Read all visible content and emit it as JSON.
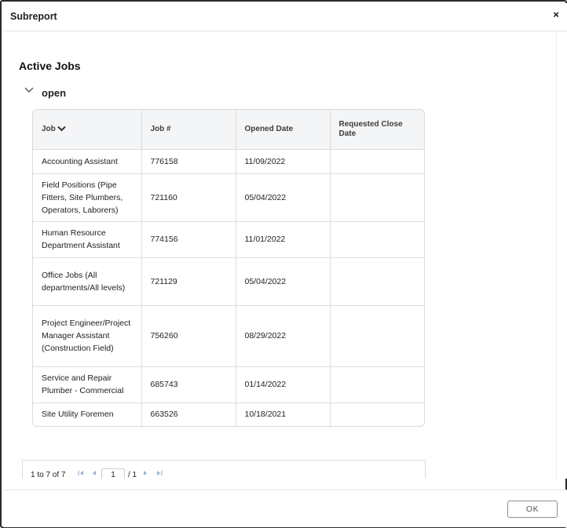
{
  "dialog": {
    "title": "Subreport",
    "close_label": "×",
    "ok_label": "OK"
  },
  "section": {
    "title": "Active Jobs"
  },
  "group": {
    "label": "open"
  },
  "table": {
    "columns": [
      "Job",
      "Job #",
      "Opened Date",
      "Requested Close Date"
    ],
    "sort_column": "Job",
    "sort_direction": "descending",
    "rows": [
      [
        "Accounting Assistant",
        "776158",
        "11/09/2022",
        ""
      ],
      [
        "Field Positions (Pipe Fitters, Site Plumbers, Operators, Laborers)",
        "721160",
        "05/04/2022",
        ""
      ],
      [
        "Human Resource Department Assistant",
        "774156",
        "11/01/2022",
        ""
      ],
      [
        "Office Jobs (All departments/All levels)",
        "721129",
        "05/04/2022",
        ""
      ],
      [
        "Project Engineer/Project Manager Assistant (Construction Field)",
        "756260",
        "08/29/2022",
        ""
      ],
      [
        "Service and Repair Plumber - Commercial",
        "685743",
        "01/14/2022",
        ""
      ],
      [
        "Site Utility Foremen",
        "663526",
        "10/18/2021",
        ""
      ]
    ]
  },
  "pager": {
    "summary": "1 to 7 of 7",
    "page_value": "1",
    "total_pages": "/ 1",
    "first_icon": "first-page-icon",
    "prev_icon": "prev-page-icon",
    "next_icon": "next-page-icon",
    "last_icon": "last-page-icon"
  },
  "colors": {
    "header_bg": "#f4f5f7",
    "border": "#dedede",
    "pager_icon": "#9bb0d6"
  }
}
